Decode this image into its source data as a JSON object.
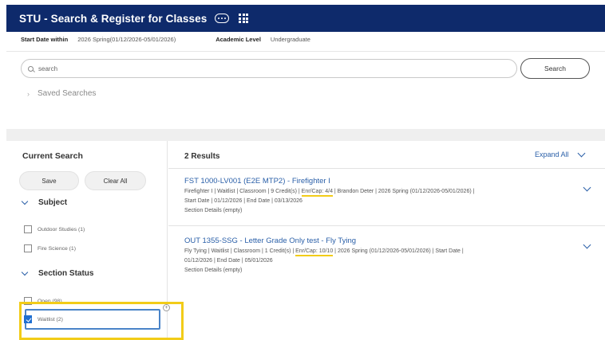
{
  "header": {
    "title": "STU - Search & Register for Classes"
  },
  "criteria": {
    "start_date_label": "Start Date within",
    "start_date_value": "2026 Spring(01/12/2026-05/01/2026)",
    "level_label": "Academic Level",
    "level_value": "Undergraduate"
  },
  "search": {
    "placeholder": "search",
    "button_label": "Search"
  },
  "saved_searches_label": "Saved Searches",
  "current_search": {
    "title": "Current Search",
    "save_label": "Save",
    "clear_label": "Clear All",
    "subject": {
      "title": "Subject",
      "items": [
        {
          "label": "Outdoor Studies (1)"
        },
        {
          "label": "Fire Science (1)"
        }
      ]
    },
    "section_status": {
      "title": "Section Status",
      "items": [
        {
          "label": "Open (98)"
        },
        {
          "label": "Waitlist (2)",
          "checked": true
        }
      ]
    }
  },
  "results": {
    "count_label": "2 Results",
    "expand_all_label": "Expand All",
    "courses": [
      {
        "title": "FST 1000-LV001 (E2E MTP2) - Firefighter I",
        "meta1_pre": "Firefighter I  |  Waitlist  |  Classroom  |  9 Credit(s)  |  ",
        "enr_cap": "Enr/Cap: 4/4",
        "meta1_post": "  |  Brandon Deter  |  2026 Spring (01/12/2026-05/01/2026)  |",
        "meta2": "Start Date  |  01/12/2026  |  End Date  |  03/13/2026",
        "meta3": "Section Details (empty)"
      },
      {
        "title": "OUT 1355-SSG - Letter Grade Only test - Fly Tying",
        "meta1_pre": "Fly Tying  |  Waitlist  |  Classroom  |  1 Credit(s)  |  ",
        "enr_cap": "Enr/Cap: 10/10",
        "meta1_post": "  |  2026 Spring (01/12/2026-05/01/2026)  |  Start Date  |",
        "meta2": "01/12/2026  |  End Date  |  05/01/2026",
        "meta3": "Section Details (empty)"
      }
    ]
  },
  "colors": {
    "header_bg": "#0e2a6b",
    "link": "#2a5fa8",
    "highlight": "#f2cc18",
    "checkbox": "#1f6fd0"
  }
}
